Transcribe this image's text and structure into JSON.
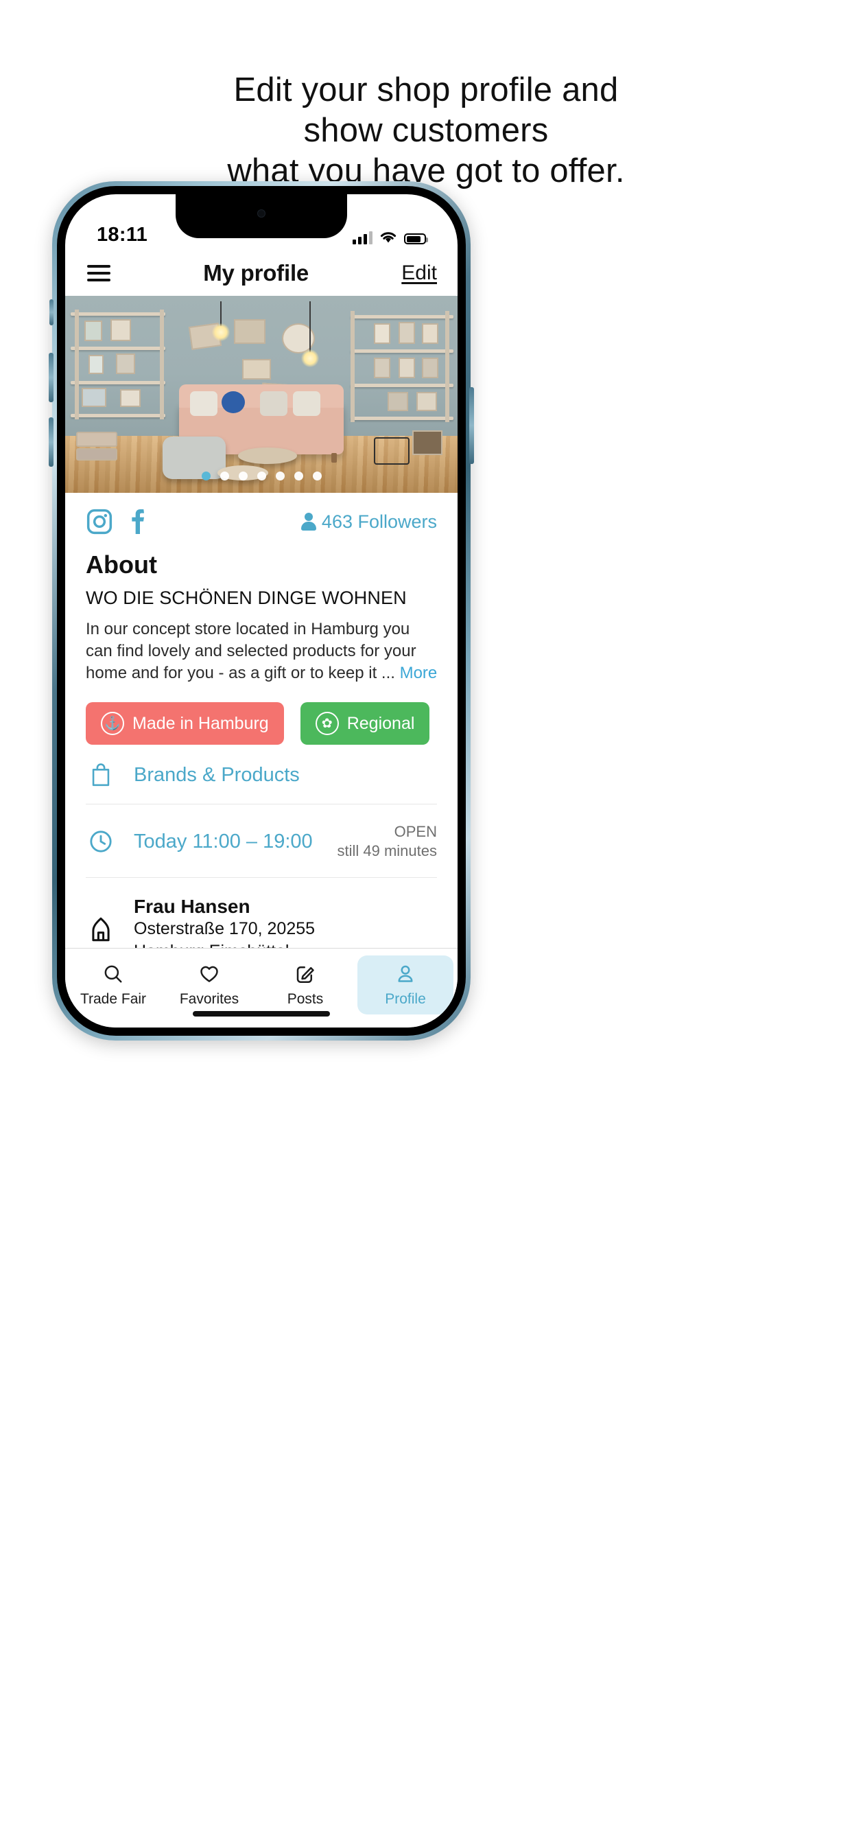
{
  "headline": {
    "line1": "Edit your shop profile and",
    "line2": "show customers",
    "line3": "what you have got to offer."
  },
  "statusbar": {
    "time": "18:11",
    "signal_icon": "cellular-bars-icon",
    "wifi_icon": "wifi-icon",
    "battery_icon": "battery-icon"
  },
  "navbar": {
    "menu_icon": "hamburger-menu-icon",
    "title": "My profile",
    "edit_label": "Edit"
  },
  "hero": {
    "alt": "concept store interior with pink sofa and shelves",
    "carousel_dots": 7,
    "active_dot_index": 0
  },
  "social": {
    "instagram_icon": "instagram-icon",
    "facebook_icon": "facebook-icon",
    "followers_icon": "person-icon",
    "followers_text": "463 Followers"
  },
  "about": {
    "heading": "About",
    "subtitle": "WO DIE SCHÖNEN DINGE WOHNEN",
    "description": "In our concept store located in Hamburg you can find lovely and selected products for your home and for you - as a gift or to keep it ...",
    "more_label": "More"
  },
  "badges": [
    {
      "label": "Made in Hamburg",
      "icon": "anchor-icon",
      "color": "#f4736f",
      "glyph": "⚓"
    },
    {
      "label": "Regional",
      "icon": "flower-icon",
      "color": "#4cb85c",
      "glyph": "✿"
    }
  ],
  "rows": {
    "brands": {
      "icon": "shopping-bag-icon",
      "label": "Brands & Products"
    },
    "hours": {
      "icon": "clock-icon",
      "label": "Today 11:00 – 19:00",
      "status": "OPEN",
      "status_detail": "still 49 minutes"
    },
    "address": {
      "icon": "home-icon",
      "name": "Frau Hansen",
      "line1": "Osterstraße 170, 20255",
      "line2": "Hamburg Eimsbüttel"
    }
  },
  "tabbar": {
    "tabs": [
      {
        "label": "Trade Fair",
        "icon": "search-icon",
        "active": false
      },
      {
        "label": "Favorites",
        "icon": "heart-icon",
        "active": false
      },
      {
        "label": "Posts",
        "icon": "edit-pencil-icon",
        "active": false
      },
      {
        "label": "Profile",
        "icon": "person-outline-icon",
        "active": true
      }
    ]
  },
  "colors": {
    "accent": "#4ba8c9",
    "accent_light": "#d9eef6",
    "badge_red": "#f4736f",
    "badge_green": "#4cb85c",
    "text": "#111111",
    "muted": "#6f6f6f"
  }
}
